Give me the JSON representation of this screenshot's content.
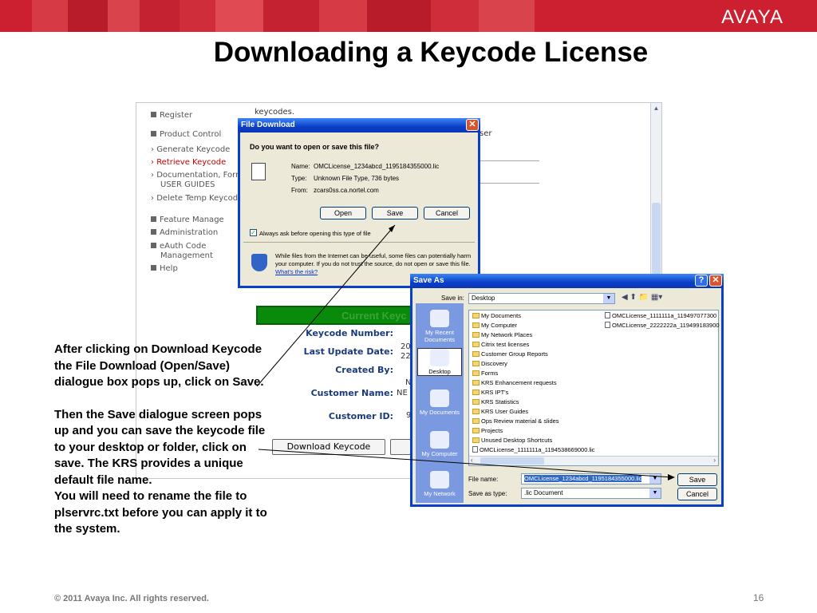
{
  "colors": {
    "accent_red": "#cc1f2f",
    "avaya_bar": [
      "#cc1f2f",
      "#b81c2a",
      "#d63a44",
      "#c42231",
      "#e04a52",
      "#b51a28",
      "#cf2d3a"
    ]
  },
  "brand": {
    "logo": "AVAYA"
  },
  "slide": {
    "title": "Downloading a Keycode License",
    "footer": "© 2011 Avaya Inc. All rights reserved.",
    "page_number": "16"
  },
  "note": {
    "p1": "After clicking on Download Keycode the File Download (Open/Save) dialogue box pops up, click on Save.",
    "p2": "Then the Save dialogue screen pops up and you can save the keycode file to your desktop or folder, click on save.  The KRS provides a unique default file name.",
    "p3": "You will need to rename the file to plservrc.txt before you can apply it to the system."
  },
  "portal": {
    "top_text": "keycodes.",
    "menu": {
      "register": "Register",
      "product_control": "Product Control",
      "generate": "Generate Keycode",
      "retrieve": "Retrieve Keycode",
      "documentation": "Documentation, Forms &",
      "user_guides": "USER GUIDES",
      "delete_temp": "Delete Temp Keycode",
      "feature_manage": "Feature Manage",
      "administration": "Administration",
      "eauth1": "eAuth Code",
      "eauth2": "Management",
      "help": "Help"
    },
    "current_keycode": "Current Keyc",
    "fields": {
      "keycode_number": "Keycode Number:",
      "last_update": "Last Update Date:",
      "created_by": "Created By:",
      "customer_name": "Customer Name:",
      "customer_id": "Customer ID:"
    },
    "values": {
      "date1": "20",
      "date2": "22",
      "n": "N",
      "ne": "NE",
      "nine": "9"
    },
    "download_button": "Download Keycode",
    "ser": "ser"
  },
  "file_download": {
    "title": "File Download",
    "question": "Do you want to open or save this file?",
    "name_label": "Name:",
    "name_value": "OMCLicense_1234abcd_1195184355000.lic",
    "type_label": "Type:",
    "type_value": "Unknown File Type, 736 bytes",
    "from_label": "From:",
    "from_value": "zcars0ss.ca.nortel.com",
    "open": "Open",
    "save": "Save",
    "cancel": "Cancel",
    "always_ask": "Always ask before opening this type of file",
    "warning": "While files from the Internet can be useful, some files can potentially harm your computer. If you do not trust the source, do not open or save this file.",
    "risk_link": "What's the risk?"
  },
  "save_as": {
    "title": "Save As",
    "save_in_label": "Save in:",
    "save_in_value": "Desktop",
    "places": [
      "My Recent Documents",
      "Desktop",
      "My Documents",
      "My Computer",
      "My Network"
    ],
    "items_left": [
      "My Documents",
      "My Computer",
      "My Network Places",
      "Citrix test licenses",
      "Customer Group Reports",
      "Discovery",
      "Forms",
      "KRS Enhancement requests",
      "KRS IPT's",
      "KRS Statistics",
      "KRS User Guides",
      "Ops Review material & slides",
      "Projects",
      "Unused Desktop Shortcuts",
      "OMCLicense_1111111a_1194538669000.lic"
    ],
    "items_right": [
      "OMCLicense_1111111a_119497077300",
      "OMCLicense_2222222a_119499183900"
    ],
    "file_name_label": "File name:",
    "file_name_value": "OMCLicense_1234abcd_1195184355000.lic",
    "save_type_label": "Save as type:",
    "save_type_value": ".lic Document",
    "save": "Save",
    "cancel": "Cancel"
  }
}
